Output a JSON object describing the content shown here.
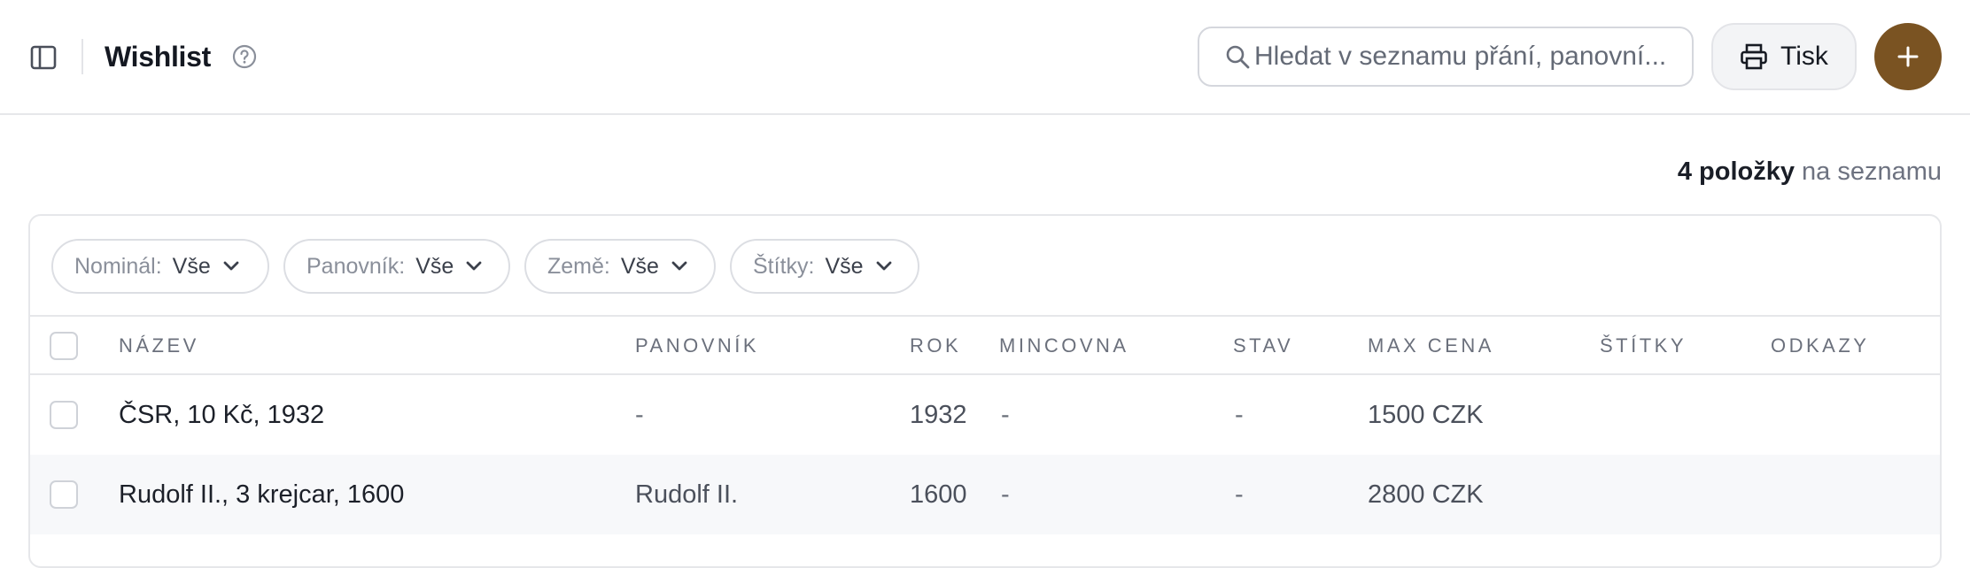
{
  "header": {
    "title": "Wishlist",
    "search_placeholder": "Hledat v seznamu přání, panovní...",
    "print_label": "Tisk",
    "accent_color": "#7a5322",
    "icons": [
      "sidebar-toggle-icon",
      "help-circle-icon",
      "search-icon",
      "printer-icon",
      "plus-icon"
    ]
  },
  "summary": {
    "count": "4 položky",
    "suffix": "na seznamu"
  },
  "filters": [
    {
      "key": "Nominál:",
      "value": "Vše"
    },
    {
      "key": "Panovník:",
      "value": "Vše"
    },
    {
      "key": "Země:",
      "value": "Vše"
    },
    {
      "key": "Štítky:",
      "value": "Vše"
    }
  ],
  "table": {
    "columns": [
      "NÁZEV",
      "PANOVNÍK",
      "ROK",
      "MINCOVNA",
      "STAV",
      "MAX CENA",
      "ŠTÍTKY",
      "ODKAZY"
    ],
    "rows": [
      {
        "name": "ČSR, 10 Kč, 1932",
        "ruler": "-",
        "year": "1932",
        "mint": "-",
        "condition": "-",
        "max_price": "1500 CZK",
        "tags": "",
        "links": ""
      },
      {
        "name": "Rudolf II., 3 krejcar, 1600",
        "ruler": "Rudolf II.",
        "year": "1600",
        "mint": "-",
        "condition": "-",
        "max_price": "2800 CZK",
        "tags": "",
        "links": ""
      }
    ]
  }
}
